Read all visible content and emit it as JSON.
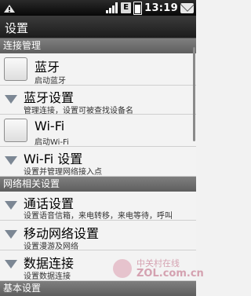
{
  "status_bar": {
    "time": "13:19",
    "icons": [
      "notification-icon",
      "signal-icon",
      "data-e-icon",
      "battery-icon",
      "mail-icon"
    ],
    "data_badge": "E"
  },
  "header": {
    "title": "设置"
  },
  "sections": [
    {
      "label": "连接管理"
    },
    {
      "label": "网络相关设置"
    },
    {
      "label": "基本设置"
    }
  ],
  "items": [
    {
      "title": "蓝牙",
      "subtitle": "启动蓝牙",
      "control": "checkbox",
      "checked": false
    },
    {
      "title": "蓝牙设置",
      "subtitle": "管理连接，设置可被查找设备名",
      "control": "arrow"
    },
    {
      "title": "Wi-Fi",
      "subtitle": "启动Wi-Fi",
      "control": "checkbox",
      "checked": false
    },
    {
      "title": "Wi-Fi 设置",
      "subtitle": "设置并管理网络接入点",
      "control": "arrow"
    },
    {
      "title": "通话设置",
      "subtitle": "设置语音信箱，来电转移，来电等待，呼叫",
      "control": "arrow"
    },
    {
      "title": "移动网络设置",
      "subtitle": "设置漫游及网络",
      "control": "arrow"
    },
    {
      "title": "数据连接",
      "subtitle": "设置数据连接",
      "control": "arrow"
    }
  ],
  "watermark": {
    "cn": "中关村在线",
    "en": "ZOL.com.cn"
  },
  "colors": {
    "section_bg": "#6e6e6e",
    "list_bg": "#f3f3f3",
    "arrow": "#7c8794"
  }
}
